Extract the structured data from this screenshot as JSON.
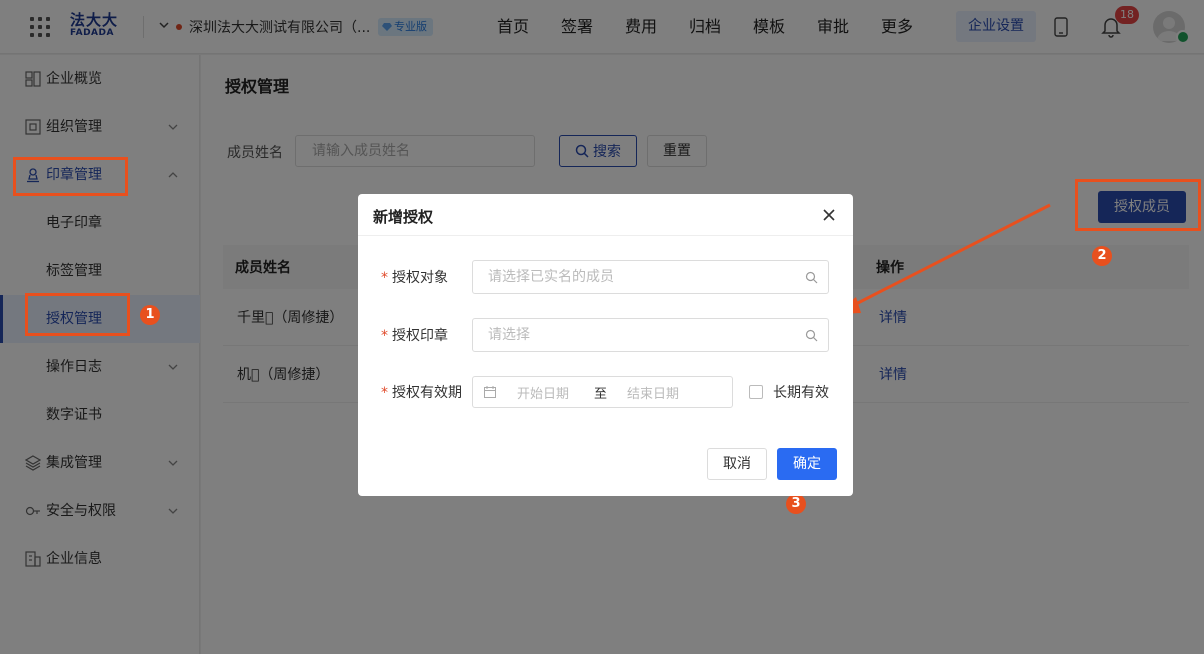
{
  "header": {
    "logo_cn": "法大大",
    "logo_en": "FADADA",
    "company_name": "深圳法大大测试有限公司（...",
    "edition_badge": "专业版",
    "nav": [
      "首页",
      "签署",
      "费用",
      "归档",
      "模板",
      "审批",
      "更多"
    ],
    "enterprise_settings": "企业设置",
    "notification_count": "18"
  },
  "sidebar": {
    "items": [
      {
        "label": "企业概览",
        "icon": "overview-icon"
      },
      {
        "label": "组织管理",
        "icon": "org-icon"
      },
      {
        "label": "印章管理",
        "icon": "seal-icon"
      },
      {
        "label": "电子印章"
      },
      {
        "label": "标签管理"
      },
      {
        "label": "授权管理"
      },
      {
        "label": "操作日志"
      },
      {
        "label": "数字证书"
      },
      {
        "label": "集成管理",
        "icon": "layers-icon"
      },
      {
        "label": "安全与权限",
        "icon": "key-icon"
      },
      {
        "label": "企业信息",
        "icon": "building-icon"
      }
    ]
  },
  "main": {
    "title": "授权管理",
    "filter_label": "成员姓名",
    "filter_placeholder": "请输入成员姓名",
    "search_button": "搜索",
    "reset_button": "重置",
    "auth_member_button": "授权成员",
    "table": {
      "columns": [
        "成员姓名",
        "操作"
      ],
      "rows": [
        {
          "name": "千里𫕸（周修捷）",
          "action": "详情"
        },
        {
          "name": "机𫕸（周修捷）",
          "action": "详情"
        }
      ]
    }
  },
  "modal": {
    "title": "新增授权",
    "required_mark": "*",
    "field_target_label": "授权对象",
    "field_target_placeholder": "请选择已实名的成员",
    "field_seal_label": "授权印章",
    "field_seal_placeholder": "请选择",
    "field_period_label": "授权有效期",
    "start_date_placeholder": "开始日期",
    "range_separator": "至",
    "end_date_placeholder": "结束日期",
    "long_term_label": "长期有效",
    "cancel_button": "取消",
    "confirm_button": "确定"
  },
  "annotations": {
    "step1": "1",
    "step2": "2",
    "step3": "3",
    "highlight_color": "#e8501e"
  },
  "colors": {
    "primary": "#2a4cb0",
    "confirm": "#2a6bf2",
    "required": "#e04a2a"
  }
}
